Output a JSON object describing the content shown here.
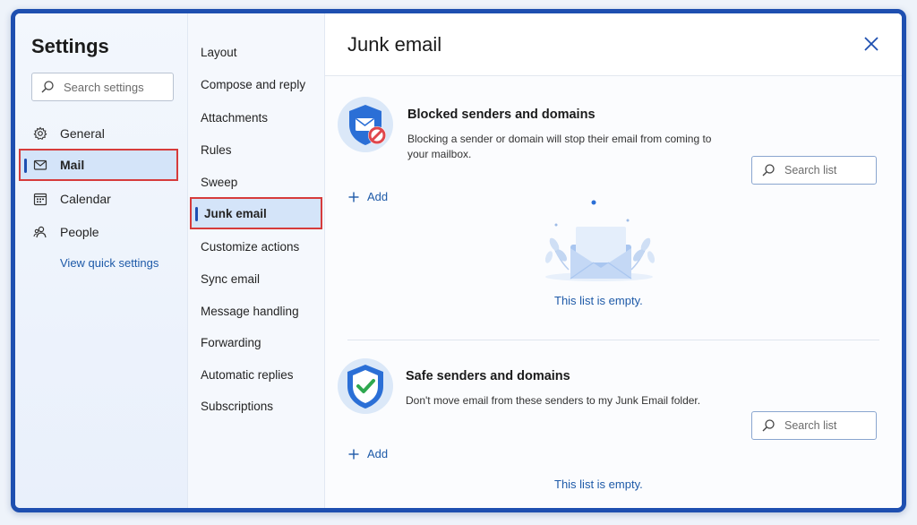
{
  "sidebar": {
    "title": "Settings",
    "search_placeholder": "Search settings",
    "items": [
      {
        "label": "General",
        "icon": "gear-icon"
      },
      {
        "label": "Mail",
        "icon": "mail-icon"
      },
      {
        "label": "Calendar",
        "icon": "calendar-icon"
      },
      {
        "label": "People",
        "icon": "people-icon"
      }
    ],
    "selected": "Mail",
    "quick_settings_link": "View quick settings"
  },
  "mail_nav": {
    "items": [
      "Layout",
      "Compose and reply",
      "Attachments",
      "Rules",
      "Sweep",
      "Junk email",
      "Customize actions",
      "Sync email",
      "Message handling",
      "Forwarding",
      "Automatic replies",
      "Subscriptions"
    ],
    "selected": "Junk email"
  },
  "main": {
    "title": "Junk email",
    "blocked": {
      "title": "Blocked senders and domains",
      "description": "Blocking a sender or domain will stop their email from coming to your mailbox.",
      "search_placeholder": "Search list",
      "add_label": "Add",
      "empty_text": "This list is empty."
    },
    "safe": {
      "title": "Safe senders and domains",
      "description": "Don't move email from these senders to my Junk Email folder.",
      "search_placeholder": "Search list",
      "add_label": "Add",
      "empty_text": "This list is empty."
    }
  },
  "colors": {
    "accent": "#1e4fb0",
    "selection_border": "#d63b3b",
    "link": "#1e5aa8"
  }
}
